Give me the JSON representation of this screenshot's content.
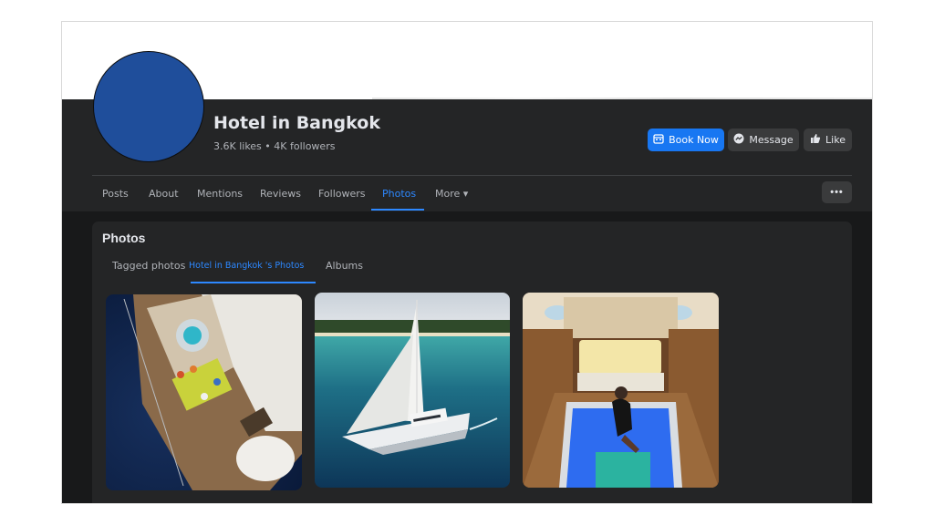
{
  "page": {
    "title": "Hotel in Bangkok",
    "stats": "3.6K likes • 4K followers"
  },
  "actions": {
    "book_label": "Book Now",
    "message_label": "Message",
    "like_label": "Like",
    "more_label": "•••"
  },
  "tabs": [
    {
      "label": "Posts"
    },
    {
      "label": "About"
    },
    {
      "label": "Mentions"
    },
    {
      "label": "Reviews"
    },
    {
      "label": "Followers"
    },
    {
      "label": "Photos",
      "active": true
    },
    {
      "label": "More ▾"
    }
  ],
  "photos_section": {
    "heading": "Photos",
    "subtabs": [
      {
        "label": "Tagged photos"
      },
      {
        "label": "Hotel in Bangkok 's Photos",
        "active": true
      },
      {
        "label": "Albums"
      }
    ]
  },
  "icons": {
    "book": "calendar-icon",
    "message": "messenger-icon",
    "like": "thumbs-up-icon"
  },
  "colors": {
    "accent": "#1877f2",
    "active_tab": "#2d88ff",
    "avatar": "#1f4e9b",
    "background": "#18191a",
    "surface": "#242526"
  }
}
